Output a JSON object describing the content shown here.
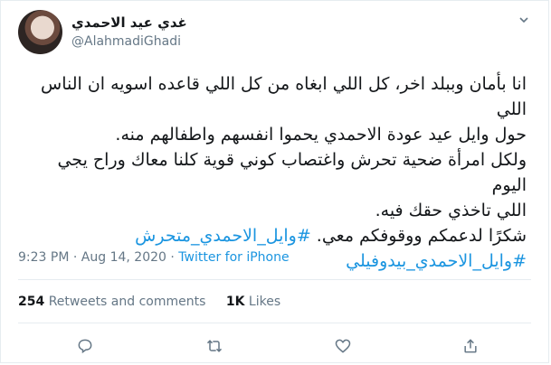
{
  "author": {
    "display_name": "غدي عيد الاحمدي",
    "handle": "@AlahmadiGhadi"
  },
  "tweet": {
    "lines": [
      "انا بأمان وببلد اخر، كل اللي ابغاه من كل اللي قاعده اسويه ان الناس اللي",
      "حول وايل عيد عودة الاحمدي يحموا انفسهم واطفالهم منه.",
      "ولكل امرأة ضحية تحرش واغتصاب كوني قوية كلنا معاك وراح يجي اليوم",
      "اللي تاخذي حقك فيه.",
      "شكرًا لدعمكم ووقوفكم معي."
    ],
    "hashtag_1": "#وايل_الاحمدي_متحرش",
    "hashtag_2": "#وايل_الاحمدي_بيدوفيلي"
  },
  "meta": {
    "time": "9:23 PM",
    "separator_1": "·",
    "date": "Aug 14, 2020",
    "separator_2": "·",
    "source": "Twitter for iPhone"
  },
  "stats": {
    "retweets_count": "254",
    "retweets_label": "Retweets and comments",
    "likes_count": "1K",
    "likes_label": "Likes"
  },
  "icons": {
    "more": "chevron-down-icon",
    "reply": "reply-icon",
    "retweet": "retweet-icon",
    "like": "heart-icon",
    "share": "share-icon"
  },
  "colors": {
    "accent": "#1b95e0",
    "muted": "#657786",
    "text": "#14171a",
    "border": "#e6ecf0"
  }
}
